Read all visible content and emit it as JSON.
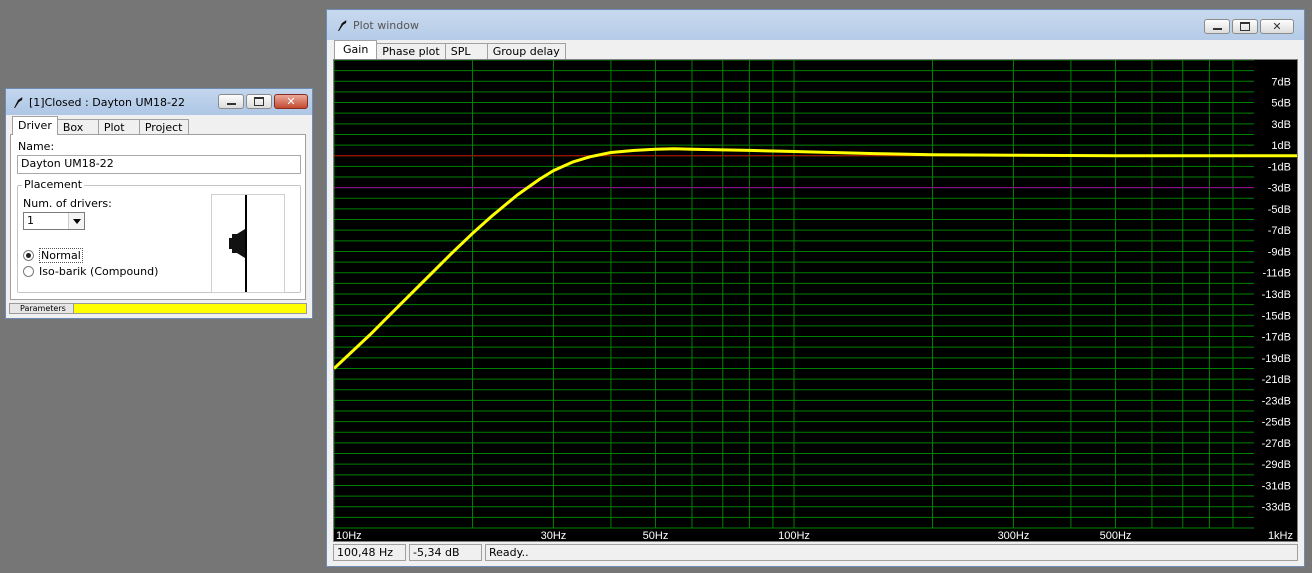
{
  "driver_window": {
    "title": "[1]Closed : Dayton UM18-22",
    "tabs": [
      "Driver",
      "Box",
      "Plot",
      "Project"
    ],
    "active_tab": "Driver",
    "name_label": "Name:",
    "name_value": "Dayton UM18-22",
    "placement_label": "Placement",
    "num_drivers_label": "Num. of drivers:",
    "num_drivers_value": "1",
    "radio_normal": "Normal",
    "radio_isobarik": "Iso-barik (Compound)",
    "selected_mode": "Normal",
    "parameters_label": "Parameters",
    "parameters_bar_color": "#ffff00"
  },
  "plot_window": {
    "title": "Plot window",
    "tabs": [
      "Gain",
      "Phase plot",
      "SPL",
      "Group delay"
    ],
    "active_tab": "Gain",
    "status": {
      "frequency": "100,48 Hz",
      "level": "-5,34 dB",
      "message": "Ready.."
    }
  },
  "chart_data": {
    "type": "line",
    "x_scale": "log",
    "xlim": [
      10,
      1000
    ],
    "ylim": [
      -35,
      9
    ],
    "grid": true,
    "background_color": "#000000",
    "grid_color": "#008000",
    "x_ticks": [
      {
        "value": 10,
        "label": "10Hz"
      },
      {
        "value": 30,
        "label": "30Hz"
      },
      {
        "value": 50,
        "label": "50Hz"
      },
      {
        "value": 100,
        "label": "100Hz"
      },
      {
        "value": 300,
        "label": "300Hz"
      },
      {
        "value": 500,
        "label": "500Hz"
      },
      {
        "value": 1000,
        "label": "1kHz"
      }
    ],
    "y_ticks": [
      7,
      5,
      3,
      1,
      -1,
      -3,
      -5,
      -7,
      -9,
      -11,
      -13,
      -15,
      -17,
      -19,
      -21,
      -23,
      -25,
      -27,
      -29,
      -31,
      -33
    ],
    "y_tick_suffix": "dB",
    "reference_lines": [
      {
        "y": 0,
        "color": "#cc0000"
      },
      {
        "y": -3,
        "color": "#a000a0"
      }
    ],
    "series": [
      {
        "color": "#ffff00",
        "x": [
          10,
          12,
          14,
          16,
          18,
          20,
          22,
          25,
          28,
          30,
          33,
          36,
          40,
          45,
          50,
          55,
          60,
          70,
          80,
          100,
          150,
          200,
          300,
          500,
          1000
        ],
        "y": [
          -20,
          -16.8,
          -13.9,
          -11.4,
          -9.2,
          -7.3,
          -5.7,
          -3.7,
          -2.2,
          -1.4,
          -0.6,
          -0.1,
          0.3,
          0.5,
          0.6,
          0.65,
          0.6,
          0.55,
          0.5,
          0.4,
          0.2,
          0.1,
          0.05,
          0,
          0
        ]
      }
    ]
  }
}
